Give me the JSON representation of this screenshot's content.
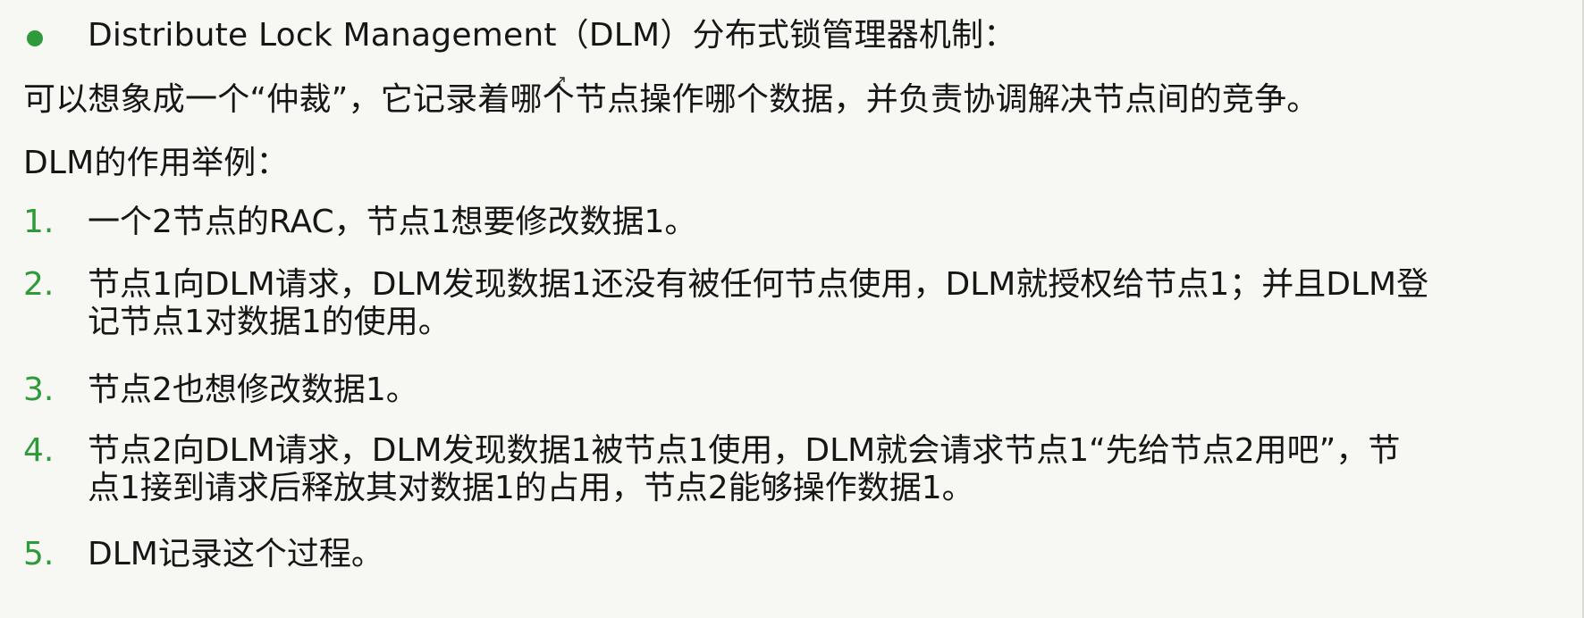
{
  "bullet": {
    "text": "Distribute Lock Management（DLM）分布式锁管理器机制："
  },
  "intro": {
    "line1": "可以想象成一个“仲裁”，它记录着哪个节点操作哪个数据，并负责协调解决节点间的竞争。",
    "line2": "DLM的作用举例："
  },
  "items": [
    {
      "marker": "1.",
      "lines": [
        "一个2节点的RAC，节点1想要修改数据1。"
      ]
    },
    {
      "marker": "2.",
      "lines": [
        "节点1向DLM请求，DLM发现数据1还没有被任何节点使用，DLM就授权给节点1；并且DLM登",
        "记节点1对数据1的使用。"
      ]
    },
    {
      "marker": "3.",
      "lines": [
        "节点2也想修改数据1。"
      ]
    },
    {
      "marker": "4.",
      "lines": [
        "节点2向DLM请求，DLM发现数据1被节点1使用，DLM就会请求节点1“先给节点2用吧”，节",
        "点1接到请求后释放其对数据1的占用，节点2能够操作数据1。"
      ]
    },
    {
      "marker": "5.",
      "lines": [
        "DLM记录这个过程。"
      ]
    }
  ],
  "colors": {
    "accent": "#2f9a3a",
    "text": "#161616",
    "background": "#f7f7f4"
  },
  "icons": {
    "bullet": "green-dot",
    "cursor": "mouse-pointer"
  }
}
